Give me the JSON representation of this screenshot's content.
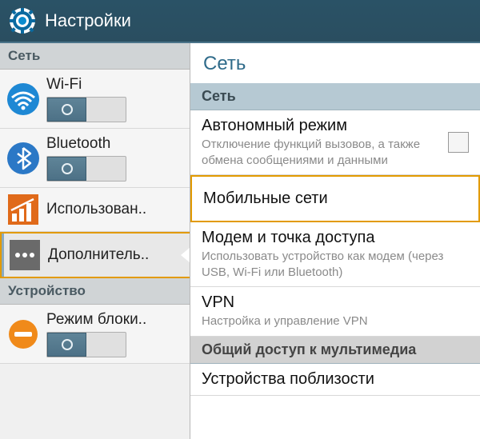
{
  "header": {
    "title": "Настройки"
  },
  "sidebar": {
    "sections": {
      "network_header": "Сеть",
      "device_header": "Устройство"
    },
    "items": [
      {
        "label": "Wi-Fi"
      },
      {
        "label": "Bluetooth"
      },
      {
        "label": "Использован.."
      },
      {
        "label": "Дополнитель.."
      },
      {
        "label": "Режим блоки.."
      }
    ]
  },
  "panel": {
    "title": "Сеть",
    "section1": "Сеть",
    "section2": "Общий доступ к мультимедиа",
    "items": [
      {
        "title": "Автономный режим",
        "sub": "Отключение функций вызовов, а также обмена сообщениями и данными"
      },
      {
        "title": "Мобильные сети"
      },
      {
        "title": "Модем и точка доступа",
        "sub": "Использовать устройство как модем (через USB, Wi-Fi или Bluetooth)"
      },
      {
        "title": "VPN",
        "sub": "Настройка и управление VPN"
      },
      {
        "title": "Устройства поблизости"
      }
    ]
  }
}
